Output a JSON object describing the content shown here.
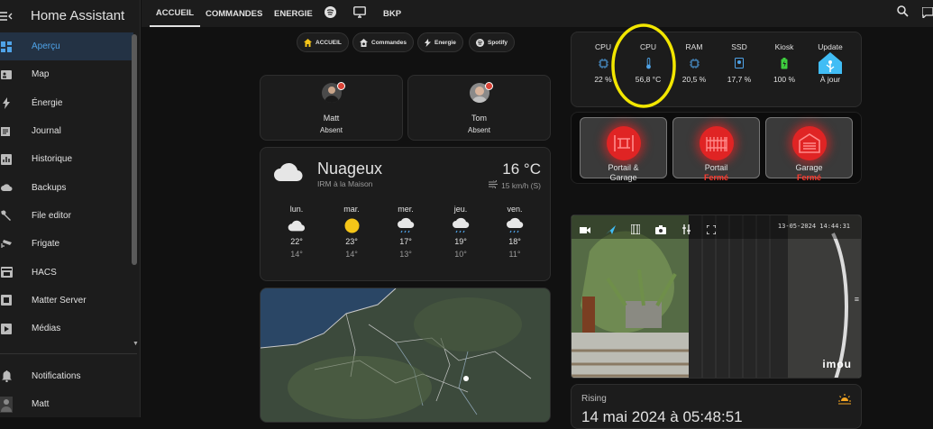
{
  "app": {
    "title": "Home Assistant"
  },
  "sidebar": {
    "items": [
      {
        "label": "Aperçu",
        "icon": "dashboard-icon",
        "active": true
      },
      {
        "label": "Map",
        "icon": "map-icon"
      },
      {
        "label": "Énergie",
        "icon": "lightning-icon"
      },
      {
        "label": "Journal",
        "icon": "journal-icon"
      },
      {
        "label": "Historique",
        "icon": "chart-icon"
      },
      {
        "label": "Backups",
        "icon": "cloud-icon"
      },
      {
        "label": "File editor",
        "icon": "wrench-icon"
      },
      {
        "label": "Frigate",
        "icon": "cctv-icon"
      },
      {
        "label": "HACS",
        "icon": "hacs-icon"
      },
      {
        "label": "Matter Server",
        "icon": "matter-icon"
      },
      {
        "label": "Médias",
        "icon": "play-icon"
      }
    ],
    "bottom": [
      {
        "label": "Notifications",
        "icon": "bell-icon"
      },
      {
        "label": "Matt",
        "icon": "user-avatar-icon"
      }
    ]
  },
  "topbar": {
    "tabs": [
      "ACCUEIL",
      "COMMANDES",
      "ENERGIE",
      "spotify",
      "monitor",
      "BKP"
    ],
    "active_tab": "ACCUEIL"
  },
  "chips": [
    {
      "label": "ACCUEIL",
      "icon": "home-icon"
    },
    {
      "label": "Commandes",
      "icon": "home-gear-icon"
    },
    {
      "label": "Energie",
      "icon": "lightning-icon"
    },
    {
      "label": "Spotify",
      "icon": "spotify-icon"
    }
  ],
  "persons": [
    {
      "name": "Matt",
      "state": "Absent"
    },
    {
      "name": "Tom",
      "state": "Absent"
    }
  ],
  "weather": {
    "condition": "Nuageux",
    "source": "IRM à la Maison",
    "temperature": "16 °C",
    "wind": "15 km/h (S)",
    "forecast": [
      {
        "day": "lun.",
        "icon": "cloudy-icon",
        "high": "22°",
        "low": "14°"
      },
      {
        "day": "mar.",
        "icon": "sun-icon",
        "high": "23°",
        "low": "14°"
      },
      {
        "day": "mer.",
        "icon": "rain-cloud-icon",
        "high": "17°",
        "low": "13°"
      },
      {
        "day": "jeu.",
        "icon": "rain-cloud-icon",
        "high": "19°",
        "low": "10°"
      },
      {
        "day": "ven.",
        "icon": "rain-cloud-icon",
        "high": "18°",
        "low": "11°"
      }
    ]
  },
  "stats": [
    {
      "label": "CPU",
      "value": "22 %"
    },
    {
      "label": "CPU",
      "value": "56,8 °C"
    },
    {
      "label": "RAM",
      "value": "20,5 %"
    },
    {
      "label": "SSD",
      "value": "17,7 %"
    },
    {
      "label": "Kiosk",
      "value": "100 %"
    },
    {
      "label": "Update",
      "value": "À jour"
    }
  ],
  "gates": [
    {
      "name": "Portail &",
      "name2": "Garage",
      "state": ""
    },
    {
      "name": "Portail",
      "state": "Fermé"
    },
    {
      "name": "Garage",
      "state": "Fermé"
    }
  ],
  "camera": {
    "timestamp": "13-05-2024 14:44:31",
    "brand": "imou"
  },
  "sun": {
    "label": "Rising",
    "datetime": "14 mai 2024 à 05:48:51"
  },
  "colors": {
    "accent": "#4fa3e8",
    "highlight": "#f2e600",
    "danger": "#e02424"
  }
}
